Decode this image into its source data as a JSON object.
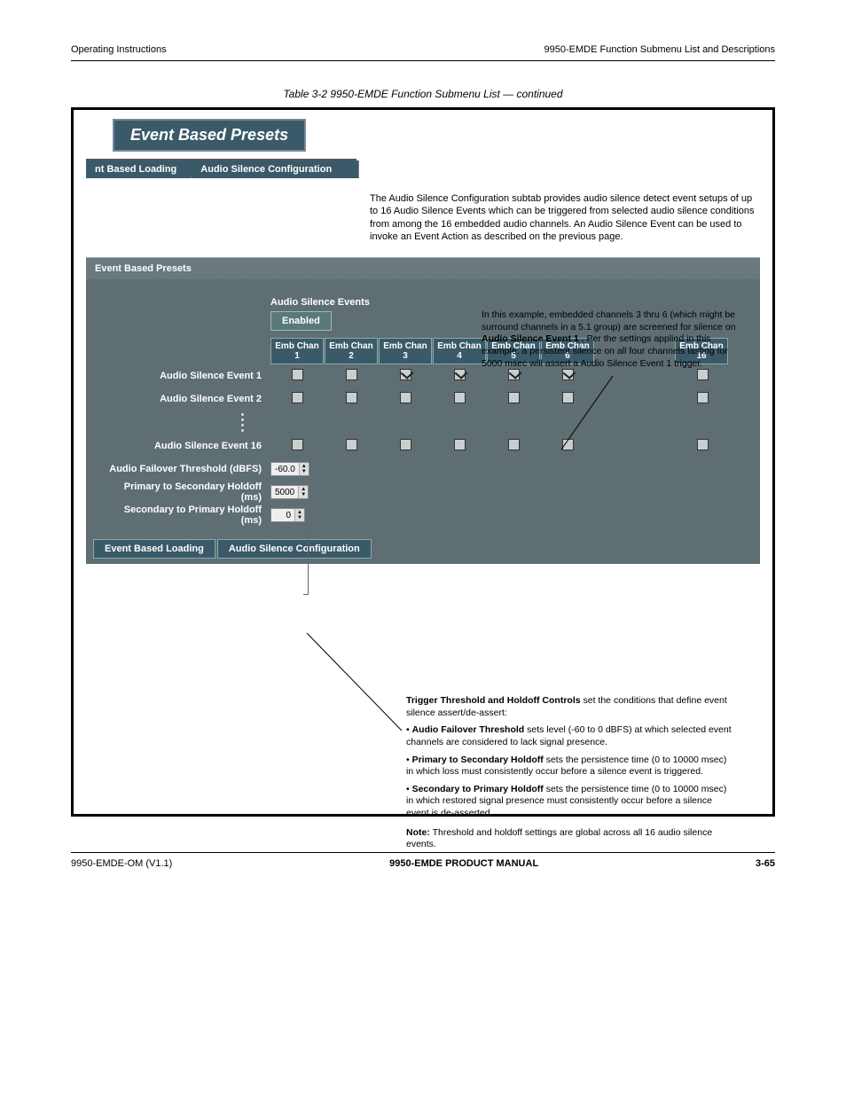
{
  "header": {
    "left": "Operating Instructions",
    "right": "9950-EMDE Function Submenu List and Descriptions"
  },
  "footer": {
    "left": "9950-EMDE-OM (V1.1)",
    "center": "9950-EMDE PRODUCT MANUAL",
    "right": "3-65"
  },
  "top_badge": "Event Based Presets",
  "tabs_top": {
    "a": "nt Based Loading",
    "b": "Audio Silence Configuration"
  },
  "context_text": "The Audio Silence Configuration subtab provides audio silence detect event setups of up to 16 Audio Silence Events which can be triggered from selected audio silence conditions from among the 16 embedded audio channels. An Audio Silence Event can be used to invoke an Event Action as described on the previous page.",
  "panel_title": "Event Based Presets",
  "section_title": "Audio Silence Events",
  "enabled_label": "Enabled",
  "col_heads": [
    "Emb Chan 1",
    "Emb Chan 2",
    "Emb Chan 3",
    "Emb Chan 4",
    "Emb Chan 5",
    "Emb Chan 6"
  ],
  "col_head_last": "Emb Chan 16",
  "rows": {
    "r1_label": "Audio Silence Event 1",
    "r2_label": "Audio Silence Event 2",
    "r16_label": "Audio Silence Event 16"
  },
  "checks_r1": [
    false,
    false,
    true,
    true,
    true,
    true,
    false
  ],
  "checks_r2": [
    false,
    false,
    false,
    false,
    false,
    false,
    false
  ],
  "checks_r16": [
    false,
    false,
    false,
    false,
    false,
    false,
    false
  ],
  "param_rows": {
    "p1_label": "Audio Failover Threshold (dBFS)",
    "p1_val": "-60.0",
    "p2_label": "Primary to Secondary Holdoff (ms)",
    "p2_val": "5000",
    "p3_label": "Secondary to Primary Holdoff (ms)",
    "p3_val": "0"
  },
  "tabs_bot": {
    "a": "Event Based Loading",
    "b": "Audio Silence Configuration"
  },
  "callouts": {
    "c1": {
      "text_a": "In this example, embedded channels 3 thru 6 (which might be surround channels in a 5.1 group) are screened for silence on ",
      "bold": "Audio Silence Event 1",
      "text_b": ". Per the settings applied in this example, a persistent silence on all four channels lasting for 5000 msec will assert a Audio Silence Event 1 trigger."
    },
    "c2": {
      "title": "Trigger Threshold and Holdoff Controls",
      "text": " set the conditions that define event silence assert/de-assert:",
      "b1a": "Audio Failover Threshold",
      "b1b": " sets level (-60 to 0 dBFS) at which selected event channels are considered to lack signal presence.",
      "b2a": "Primary to Secondary Holdoff",
      "b2b": " sets the persistence time (0 to 10000 msec) in which loss must consistently occur before a silence event is triggered.",
      "b3a": "Secondary to Primary Holdoff",
      "b3b": " sets the persistence time (0 to 10000 msec) in which restored signal presence must consistently occur before a silence event is de-asserted.",
      "note_label": "Note:",
      "note": " Threshold and holdoff settings are global across all 16 audio silence events."
    }
  },
  "table_caption": "Table 3-2  9950-EMDE Function Submenu List — continued"
}
